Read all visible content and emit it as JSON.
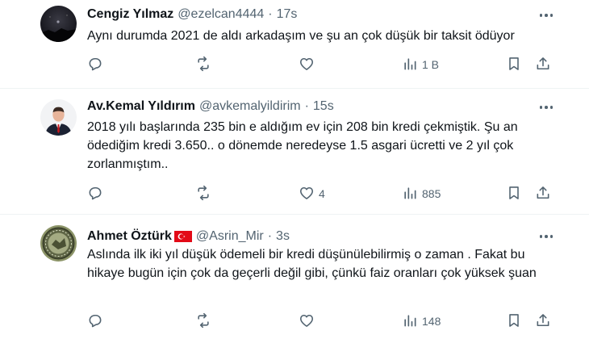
{
  "tweets": [
    {
      "name": "Cengiz Yılmaz",
      "handle": "@ezelcan4444",
      "separator": "·",
      "time": "17s",
      "text": "Aynı durumda 2021 de aldı arkadaşım ve şu an çok düşük bir taksit ödüyor",
      "likes": "",
      "views": "1 B",
      "has_flag": false
    },
    {
      "name": "Av.Kemal Yıldırım",
      "handle": "@avkemalyildirim",
      "separator": "·",
      "time": "15s",
      "text": "2018 yılı başlarında 235 bin e aldığım ev için 208 bin kredi çekmiştik. Şu an ödediğim kredi 3.650.. o dönemde neredeyse 1.5 asgari ücretti ve 2 yıl çok zorlanmıştım..",
      "likes": "4",
      "views": "885",
      "has_flag": false
    },
    {
      "name": "Ahmet Öztürk",
      "handle": "@Asrin_Mir",
      "separator": "·",
      "time": "3s",
      "text": "Aslında ilk iki yıl düşük ödemeli bir kredi düşünülebilirmiş o zaman . Fakat bu hikaye bugün için çok da geçerli değil gibi, çünkü  faiz oranları çok yüksek şuan",
      "likes": "",
      "views": "148",
      "has_flag": true
    }
  ],
  "icons": {
    "reply": "reply-icon",
    "retweet": "retweet-icon",
    "like": "heart-icon",
    "views": "views-icon",
    "bookmark": "bookmark-icon",
    "share": "share-icon",
    "more": "more-icon",
    "flag": "turkey-flag-icon"
  },
  "colors": {
    "text": "#0f1419",
    "secondary": "#536471",
    "divider": "#eff3f4",
    "flag_red": "#e30a17"
  }
}
